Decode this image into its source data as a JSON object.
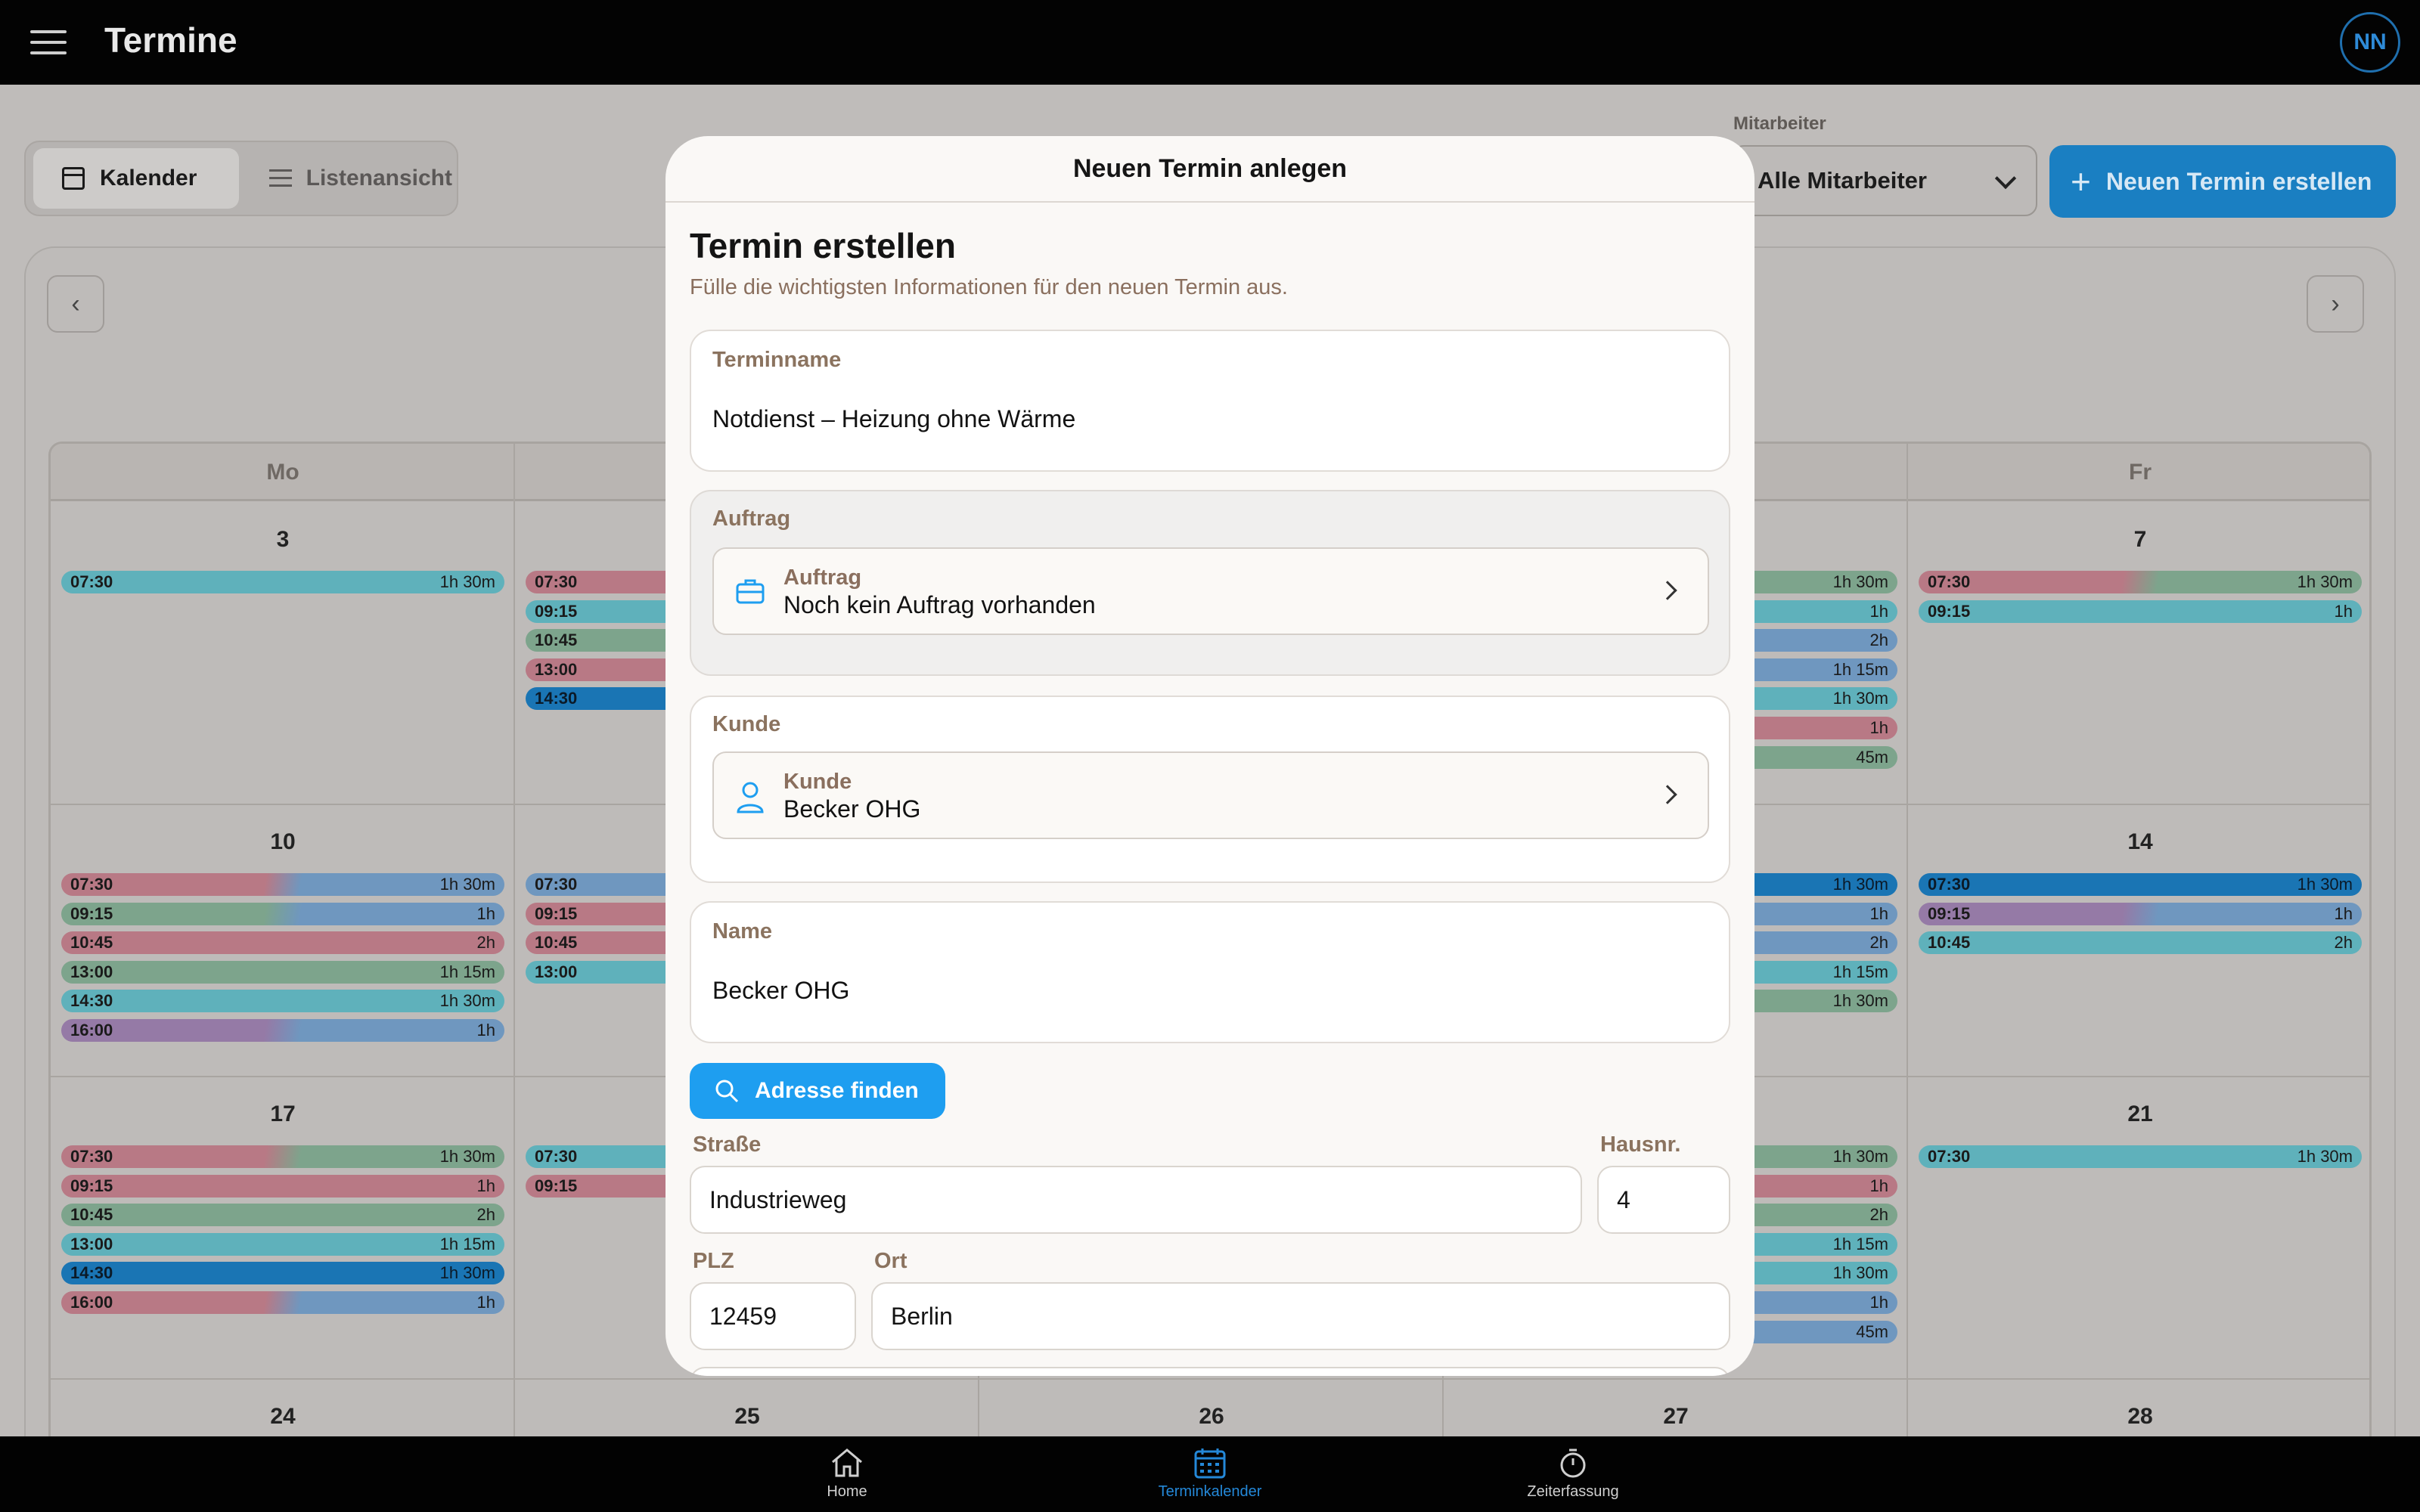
{
  "app": {
    "title": "Termine",
    "avatar": "NN"
  },
  "toolbar": {
    "views": [
      {
        "label": "Kalender",
        "icon": "calendar-icon",
        "active": true
      },
      {
        "label": "Listenansicht",
        "icon": "list-icon",
        "active": false
      }
    ],
    "mitarbeiter_label": "Mitarbeiter",
    "mitarbeiter_value": "Alle Mitarbeiter",
    "new_button": "Neuen Termin erstellen"
  },
  "calendar": {
    "weekdays": [
      "Mo",
      "",
      "",
      "",
      "Fr"
    ],
    "day_numbers": [
      [
        "3",
        "",
        "",
        "",
        "7"
      ],
      [
        "10",
        "",
        "",
        "",
        "14"
      ],
      [
        "17",
        "",
        "",
        "",
        "21"
      ],
      [
        "24",
        "25",
        "26",
        "27",
        "28"
      ]
    ],
    "colors": {
      "teal": "#5fb1bb",
      "pink": "#b87985",
      "green": "#7da48c",
      "blue": "#6f97bf",
      "purple": "#957aa6",
      "darkblue": "#1a75b4"
    }
  },
  "modal": {
    "header": "Neuen Termin anlegen",
    "title": "Termin erstellen",
    "subtitle": "Fülle die wichtigsten Informationen für den neuen Termin aus.",
    "terminname": {
      "label": "Terminname",
      "value": "Notdienst – Heizung ohne Wärme"
    },
    "auftrag": {
      "section_label": "Auftrag",
      "label": "Auftrag",
      "value": "Noch kein Auftrag vorhanden"
    },
    "kunde": {
      "section_label": "Kunde",
      "label": "Kunde",
      "value": "Becker OHG"
    },
    "name": {
      "label": "Name",
      "value": "Becker OHG"
    },
    "find_button": "Adresse finden",
    "strasse": {
      "label": "Straße",
      "value": "Industrieweg"
    },
    "hausnr": {
      "label": "Hausnr.",
      "value": "4"
    },
    "plz": {
      "label": "PLZ",
      "value": "12459"
    },
    "ort": {
      "label": "Ort",
      "value": "Berlin"
    }
  },
  "bottom_nav": [
    {
      "label": "Home",
      "icon": "home-icon",
      "active": false
    },
    {
      "label": "Terminkalender",
      "icon": "calendar-icon",
      "active": true
    },
    {
      "label": "Zeiterfassung",
      "icon": "stopwatch-icon",
      "active": false
    }
  ],
  "events": [
    {
      "col": 0,
      "row": 0,
      "slot": 0,
      "time": "07:30",
      "dur": "1h 30m",
      "colors": [
        "teal"
      ]
    },
    {
      "col": 1,
      "row": 0,
      "slot": 0,
      "time": "07:30",
      "dur": "",
      "colors": [
        "pink"
      ]
    },
    {
      "col": 1,
      "row": 0,
      "slot": 1,
      "time": "09:15",
      "dur": "",
      "colors": [
        "teal"
      ]
    },
    {
      "col": 1,
      "row": 0,
      "slot": 2,
      "time": "10:45",
      "dur": "",
      "colors": [
        "green"
      ]
    },
    {
      "col": 1,
      "row": 0,
      "slot": 3,
      "time": "13:00",
      "dur": "",
      "colors": [
        "pink"
      ]
    },
    {
      "col": 1,
      "row": 0,
      "slot": 4,
      "time": "14:30",
      "dur": "",
      "colors": [
        "darkblue"
      ]
    },
    {
      "col": 3,
      "row": 0,
      "slot": 0,
      "time": "",
      "dur": "1h 30m",
      "colors": [
        "green"
      ]
    },
    {
      "col": 3,
      "row": 0,
      "slot": 1,
      "time": "",
      "dur": "1h",
      "colors": [
        "teal"
      ]
    },
    {
      "col": 3,
      "row": 0,
      "slot": 2,
      "time": "",
      "dur": "2h",
      "colors": [
        "blue"
      ]
    },
    {
      "col": 3,
      "row": 0,
      "slot": 3,
      "time": "",
      "dur": "1h 15m",
      "colors": [
        "blue"
      ]
    },
    {
      "col": 3,
      "row": 0,
      "slot": 4,
      "time": "",
      "dur": "1h 30m",
      "colors": [
        "teal"
      ]
    },
    {
      "col": 3,
      "row": 0,
      "slot": 5,
      "time": "",
      "dur": "1h",
      "colors": [
        "pink"
      ]
    },
    {
      "col": 3,
      "row": 0,
      "slot": 6,
      "time": "",
      "dur": "45m",
      "colors": [
        "green"
      ]
    },
    {
      "col": 4,
      "row": 0,
      "slot": 0,
      "time": "07:30",
      "dur": "1h 30m",
      "colors": [
        "pink",
        "green"
      ]
    },
    {
      "col": 4,
      "row": 0,
      "slot": 1,
      "time": "09:15",
      "dur": "1h",
      "colors": [
        "teal"
      ]
    },
    {
      "col": 0,
      "row": 1,
      "slot": 0,
      "time": "07:30",
      "dur": "1h 30m",
      "colors": [
        "pink",
        "blue"
      ]
    },
    {
      "col": 0,
      "row": 1,
      "slot": 1,
      "time": "09:15",
      "dur": "1h",
      "colors": [
        "green",
        "blue"
      ]
    },
    {
      "col": 0,
      "row": 1,
      "slot": 2,
      "time": "10:45",
      "dur": "2h",
      "colors": [
        "pink"
      ]
    },
    {
      "col": 0,
      "row": 1,
      "slot": 3,
      "time": "13:00",
      "dur": "1h 15m",
      "colors": [
        "green"
      ]
    },
    {
      "col": 0,
      "row": 1,
      "slot": 4,
      "time": "14:30",
      "dur": "1h 30m",
      "colors": [
        "teal"
      ]
    },
    {
      "col": 0,
      "row": 1,
      "slot": 5,
      "time": "16:00",
      "dur": "1h",
      "colors": [
        "purple",
        "blue"
      ]
    },
    {
      "col": 1,
      "row": 1,
      "slot": 0,
      "time": "07:30",
      "dur": "",
      "colors": [
        "blue"
      ]
    },
    {
      "col": 1,
      "row": 1,
      "slot": 1,
      "time": "09:15",
      "dur": "",
      "colors": [
        "pink"
      ]
    },
    {
      "col": 1,
      "row": 1,
      "slot": 2,
      "time": "10:45",
      "dur": "",
      "colors": [
        "pink"
      ]
    },
    {
      "col": 1,
      "row": 1,
      "slot": 3,
      "time": "13:00",
      "dur": "",
      "colors": [
        "teal"
      ]
    },
    {
      "col": 3,
      "row": 1,
      "slot": 0,
      "time": "",
      "dur": "1h 30m",
      "colors": [
        "darkblue"
      ]
    },
    {
      "col": 3,
      "row": 1,
      "slot": 1,
      "time": "",
      "dur": "1h",
      "colors": [
        "blue"
      ]
    },
    {
      "col": 3,
      "row": 1,
      "slot": 2,
      "time": "",
      "dur": "2h",
      "colors": [
        "blue"
      ]
    },
    {
      "col": 3,
      "row": 1,
      "slot": 3,
      "time": "",
      "dur": "1h 15m",
      "colors": [
        "teal"
      ]
    },
    {
      "col": 3,
      "row": 1,
      "slot": 4,
      "time": "",
      "dur": "1h 30m",
      "colors": [
        "green"
      ]
    },
    {
      "col": 4,
      "row": 1,
      "slot": 0,
      "time": "07:30",
      "dur": "1h 30m",
      "colors": [
        "darkblue"
      ]
    },
    {
      "col": 4,
      "row": 1,
      "slot": 1,
      "time": "09:15",
      "dur": "1h",
      "colors": [
        "purple",
        "blue"
      ]
    },
    {
      "col": 4,
      "row": 1,
      "slot": 2,
      "time": "10:45",
      "dur": "2h",
      "colors": [
        "teal"
      ]
    },
    {
      "col": 0,
      "row": 2,
      "slot": 0,
      "time": "07:30",
      "dur": "1h 30m",
      "colors": [
        "pink",
        "green"
      ]
    },
    {
      "col": 0,
      "row": 2,
      "slot": 1,
      "time": "09:15",
      "dur": "1h",
      "colors": [
        "pink"
      ]
    },
    {
      "col": 0,
      "row": 2,
      "slot": 2,
      "time": "10:45",
      "dur": "2h",
      "colors": [
        "green"
      ]
    },
    {
      "col": 0,
      "row": 2,
      "slot": 3,
      "time": "13:00",
      "dur": "1h 15m",
      "colors": [
        "teal"
      ]
    },
    {
      "col": 0,
      "row": 2,
      "slot": 4,
      "time": "14:30",
      "dur": "1h 30m",
      "colors": [
        "darkblue"
      ]
    },
    {
      "col": 0,
      "row": 2,
      "slot": 5,
      "time": "16:00",
      "dur": "1h",
      "colors": [
        "pink",
        "blue"
      ]
    },
    {
      "col": 1,
      "row": 2,
      "slot": 0,
      "time": "07:30",
      "dur": "",
      "colors": [
        "teal"
      ]
    },
    {
      "col": 1,
      "row": 2,
      "slot": 1,
      "time": "09:15",
      "dur": "",
      "colors": [
        "pink"
      ]
    },
    {
      "col": 3,
      "row": 2,
      "slot": 0,
      "time": "",
      "dur": "1h 30m",
      "colors": [
        "green"
      ]
    },
    {
      "col": 3,
      "row": 2,
      "slot": 1,
      "time": "",
      "dur": "1h",
      "colors": [
        "pink"
      ]
    },
    {
      "col": 3,
      "row": 2,
      "slot": 2,
      "time": "",
      "dur": "2h",
      "colors": [
        "green"
      ]
    },
    {
      "col": 3,
      "row": 2,
      "slot": 3,
      "time": "",
      "dur": "1h 15m",
      "colors": [
        "teal"
      ]
    },
    {
      "col": 3,
      "row": 2,
      "slot": 4,
      "time": "",
      "dur": "1h 30m",
      "colors": [
        "teal"
      ]
    },
    {
      "col": 3,
      "row": 2,
      "slot": 5,
      "time": "",
      "dur": "1h",
      "colors": [
        "blue"
      ]
    },
    {
      "col": 3,
      "row": 2,
      "slot": 6,
      "time": "",
      "dur": "45m",
      "colors": [
        "blue"
      ]
    },
    {
      "col": 4,
      "row": 2,
      "slot": 0,
      "time": "07:30",
      "dur": "1h 30m",
      "colors": [
        "teal"
      ]
    }
  ]
}
